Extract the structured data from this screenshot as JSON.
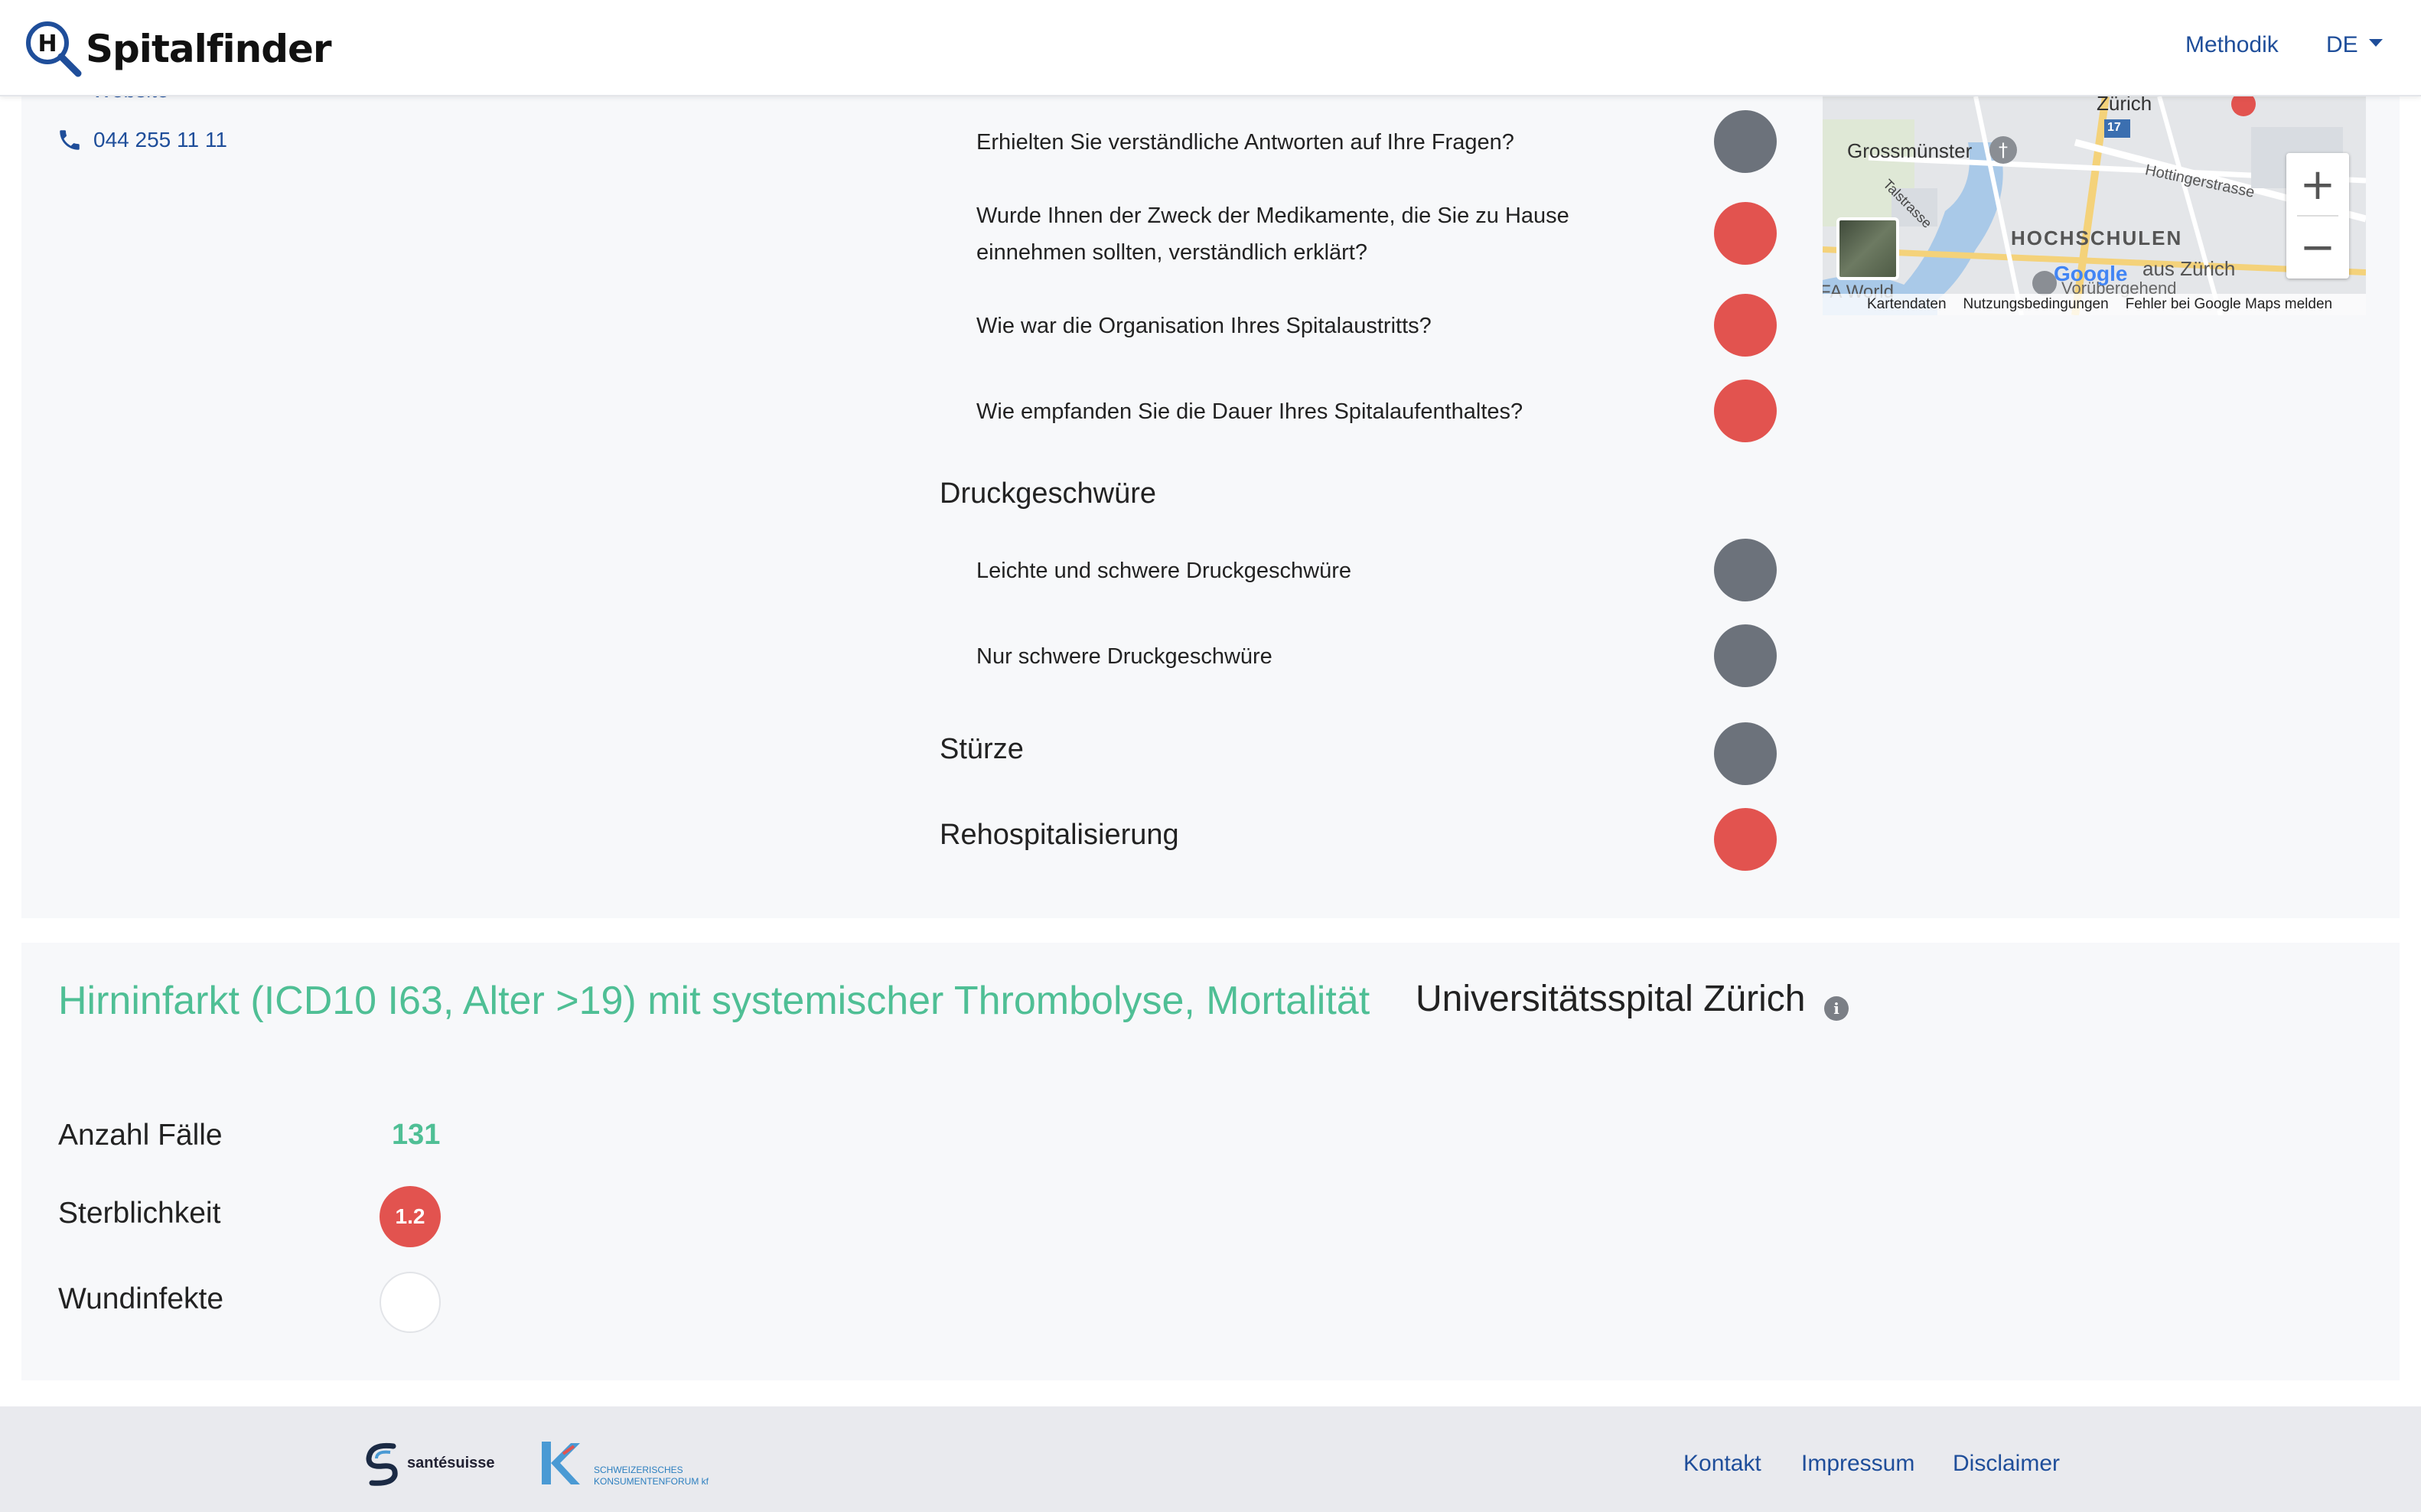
{
  "header": {
    "brand": "Spitalfinder",
    "nav_methodik": "Methodik",
    "nav_lang": "DE"
  },
  "contact": {
    "website": "Website",
    "phone": "044 255 11 11"
  },
  "questions": [
    {
      "text": "Erhielten Sie verständliche Antworten auf Ihre Fragen?",
      "status": "grey"
    },
    {
      "text": "Wurde Ihnen der Zweck der Medikamente, die Sie zu Hause einnehmen sollten, verständlich erklärt?",
      "status": "red"
    },
    {
      "text": "Wie war die Organisation Ihres Spitalaustritts?",
      "status": "red"
    },
    {
      "text": "Wie empfanden Sie die Dauer Ihres Spitalaufenthaltes?",
      "status": "red"
    }
  ],
  "sections": {
    "druck": {
      "title": "Druckgeschwüre"
    },
    "druck_items": [
      {
        "text": "Leichte und schwere Druckgeschwüre",
        "status": "grey"
      },
      {
        "text": "Nur schwere Druckgeschwüre",
        "status": "grey"
      }
    ],
    "stuerze": {
      "title": "Stürze",
      "status": "grey"
    },
    "rehosp": {
      "title": "Rehospitalisierung",
      "status": "red"
    }
  },
  "map": {
    "labels": {
      "zurich": "Zürich",
      "grossmuenster": "Grossmünster",
      "hochschulen": "HOCHSCHULEN",
      "hottinger": "Hottingerstrasse",
      "talstrasse": "Talstrasse",
      "spital": "aus Zürich",
      "voruebergehend": "Vorübergehend",
      "fa_world": "FA World",
      "route": "17",
      "google": "Google"
    },
    "attrib": {
      "kartendaten": "Kartendaten",
      "nutzung": "Nutzungsbedingungen",
      "fehler": "Fehler bei Google Maps melden"
    },
    "zoom_in": "+",
    "zoom_out": "−"
  },
  "indicator": {
    "title": "Hirninfarkt (ICD10 I63, Alter >19) mit systemischer Thrombolyse, Mortalität",
    "hospital": "Universitätsspital Zürich",
    "info": "i",
    "metrics": {
      "faelle_label": "Anzahl Fälle",
      "faelle_value": "131",
      "sterb_label": "Sterblichkeit",
      "sterb_value": "1.2",
      "wund_label": "Wundinfekte"
    }
  },
  "footer": {
    "santesuisse": "santésuisse",
    "kf_line1": "SCHWEIZERISCHES",
    "kf_line2": "KONSUMENTENFORUM kf",
    "links": [
      "Kontakt",
      "Impressum",
      "Disclaimer"
    ]
  },
  "colors": {
    "accent_green": "#4fbf95",
    "link_blue": "#1f4e9a",
    "status_red": "#e2534f",
    "status_grey": "#6c727b"
  }
}
